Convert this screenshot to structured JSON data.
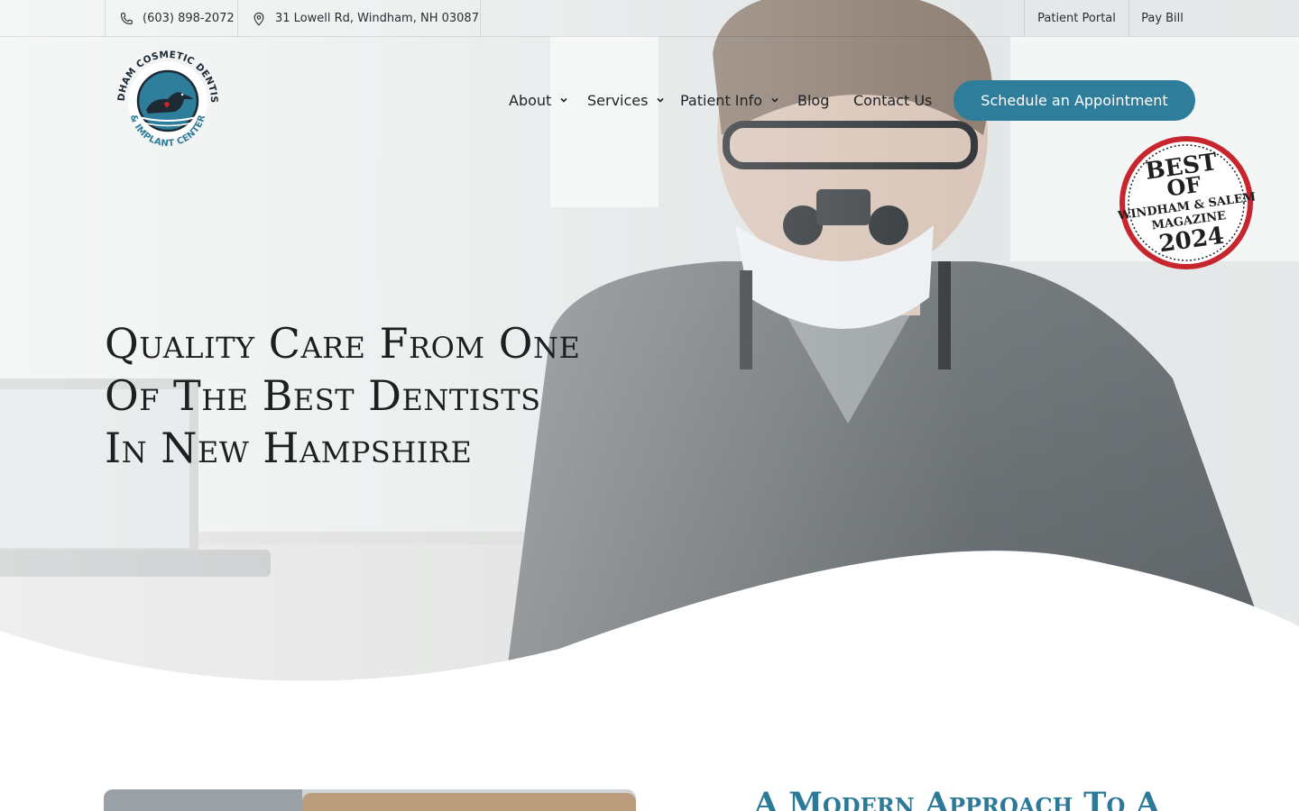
{
  "colors": {
    "brand_teal": "#2e7d9b",
    "text_dark": "#1f2326",
    "badge_red": "#c8262e",
    "subheading_teal": "#2b7a99"
  },
  "topbar": {
    "phone": "(603) 898-2072",
    "address": "31 Lowell Rd, Windham, NH 03087",
    "patient_portal": "Patient Portal",
    "pay_bill": "Pay Bill",
    "phone_icon": "phone-icon",
    "address_icon": "map-pin-icon"
  },
  "logo": {
    "arc_top": "WINDHAM COSMETIC DENTISTRY",
    "arc_bottom": "& IMPLANT CENTER",
    "icon": "loon-icon"
  },
  "nav": {
    "items": [
      {
        "label": "About",
        "has_dropdown": true
      },
      {
        "label": "Services",
        "has_dropdown": true
      },
      {
        "label": "Patient Info",
        "has_dropdown": true
      },
      {
        "label": "Blog",
        "has_dropdown": false
      },
      {
        "label": "Contact Us",
        "has_dropdown": false
      }
    ],
    "cta_label": "Schedule an Appointment"
  },
  "badge": {
    "line1": "BEST",
    "line2": "OF",
    "line3": "WINDHAM & SALEM",
    "line4": "MAGAZINE",
    "line5": "2024"
  },
  "hero": {
    "headline_lines": [
      "Quality Care From One",
      "Of The Best Dentists",
      "In New Hampshire"
    ]
  },
  "section2": {
    "heading": "A Modern Approach To A"
  }
}
